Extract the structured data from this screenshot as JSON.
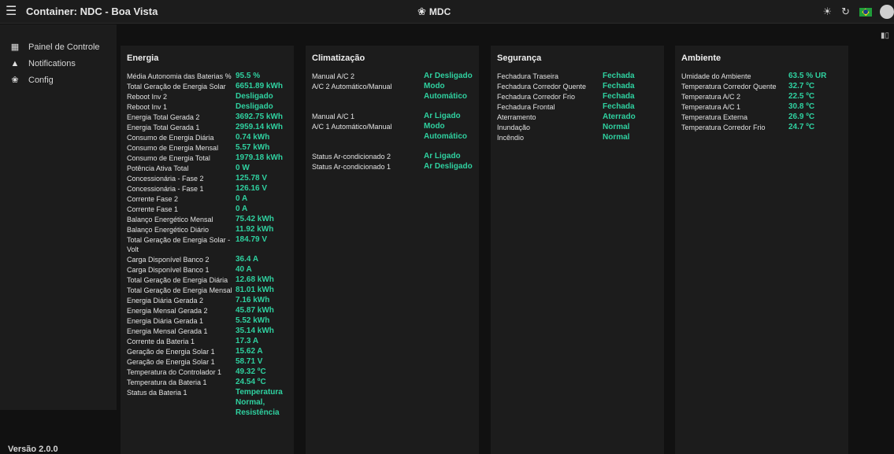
{
  "header": {
    "menu_icon": "menu-icon",
    "title": "Container: NDC - Boa Vista",
    "center_title": "MDC",
    "center_icon": "gear-icon",
    "actions": [
      "brightness-icon",
      "refresh-icon",
      "brazil-flag-icon",
      "user-avatar"
    ]
  },
  "sidebar": {
    "items": [
      {
        "label": "Painel de Controle",
        "icon": "dashboard-icon"
      },
      {
        "label": "Notifications",
        "icon": "bell-icon"
      },
      {
        "label": "Config",
        "icon": "gear-icon"
      }
    ],
    "version": "Versão 2.0.0"
  },
  "colors": {
    "value": "#2fd1a0",
    "card": "#1c1c1c",
    "background": "#111111"
  },
  "cards": {
    "energia": {
      "title": "Energia",
      "rows": [
        {
          "label": "Média Autonomia das Baterias %",
          "value": "95.5 %"
        },
        {
          "label": "Total Geração de Energia Solar",
          "value": "6651.89 kWh"
        },
        {
          "label": "Reboot Inv 2",
          "value": "Desligado"
        },
        {
          "label": "Reboot Inv 1",
          "value": "Desligado"
        },
        {
          "label": "Energia Total Gerada 2",
          "value": "3692.75 kWh"
        },
        {
          "label": "Energia Total Gerada 1",
          "value": "2959.14 kWh"
        },
        {
          "label": "Consumo de Energia Diária",
          "value": "0.74 kWh"
        },
        {
          "label": "Consumo de Energia Mensal",
          "value": "5.57 kWh"
        },
        {
          "label": "Consumo de Energia Total",
          "value": "1979.18 kWh"
        },
        {
          "label": "Potência Ativa Total",
          "value": "0 W"
        },
        {
          "label": "Concessionária - Fase 2",
          "value": "125.78 V"
        },
        {
          "label": "Concessionária - Fase 1",
          "value": "126.16 V"
        },
        {
          "label": "Corrente Fase 2",
          "value": "0 A"
        },
        {
          "label": "Corrente Fase 1",
          "value": "0 A"
        },
        {
          "label": "Balanço Energético Mensal",
          "value": "75.42 kWh"
        },
        {
          "label": "Balanço Energético Diário",
          "value": "11.92 kWh"
        },
        {
          "label": "Total Geração de Energia Solar - Volt",
          "value": "184.79 V"
        },
        {
          "label": "Carga Disponível Banco 2",
          "value": "36.4 A"
        },
        {
          "label": "Carga Disponível Banco 1",
          "value": "40 A"
        },
        {
          "label": "Total Geração de Energia Diária",
          "value": "12.68 kWh"
        },
        {
          "label": "Total Geração de Energia Mensal",
          "value": "81.01 kWh"
        },
        {
          "label": "Energia Diária Gerada 2",
          "value": "7.16 kWh"
        },
        {
          "label": "Energia Mensal Gerada 2",
          "value": "45.87 kWh"
        },
        {
          "label": "Energia Diária Gerada 1",
          "value": "5.52 kWh"
        },
        {
          "label": "Energia Mensal Gerada 1",
          "value": "35.14 kWh"
        },
        {
          "label": "Corrente da Bateria 1",
          "value": "17.3 A"
        },
        {
          "label": "Geração de Energia Solar 1",
          "value": "15.62 A"
        },
        {
          "label": "Geração de Energia Solar 1",
          "value": "58.71 V"
        },
        {
          "label": "Temperatura do Controlador 1",
          "value": "49.32 ºC"
        },
        {
          "label": "Temperatura da Bateria 1",
          "value": "24.54 ºC"
        },
        {
          "label": "Status da Bateria 1",
          "value": "Temperatura Normal, Resistência"
        }
      ]
    },
    "climatizacao": {
      "title": "Climatização",
      "rows": [
        {
          "label": "Manual A/C 2",
          "value": "Ar Desligado"
        },
        {
          "label": "A/C 2 Automático/Manual",
          "value": "Modo Automático"
        },
        {
          "label": "Manual A/C 1",
          "value": "Ar Ligado"
        },
        {
          "label": "A/C 1 Automático/Manual",
          "value": "Modo Automático"
        },
        {
          "label": "Status Ar-condicionado 2",
          "value": "Ar Ligado"
        },
        {
          "label": "Status Ar-condicionado 1",
          "value": "Ar Desligado"
        }
      ]
    },
    "seguranca": {
      "title": "Segurança",
      "rows": [
        {
          "label": "Fechadura Traseira",
          "value": "Fechada"
        },
        {
          "label": "Fechadura Corredor Quente",
          "value": "Fechada"
        },
        {
          "label": "Fechadura Corredor Frio",
          "value": "Fechada"
        },
        {
          "label": "Fechadura Frontal",
          "value": "Fechada"
        },
        {
          "label": "Aterramento",
          "value": "Aterrado"
        },
        {
          "label": "Inundação",
          "value": "Normal"
        },
        {
          "label": "Incêndio",
          "value": "Normal"
        }
      ]
    },
    "ambiente": {
      "title": "Ambiente",
      "rows": [
        {
          "label": "Umidade do Ambiente",
          "value": "63.5 % UR"
        },
        {
          "label": "Temperatura Corredor Quente",
          "value": "32.7 ºC"
        },
        {
          "label": "Temperatura A/C 2",
          "value": "22.5 ºC"
        },
        {
          "label": "Temperatura A/C 1",
          "value": "30.8 ºC"
        },
        {
          "label": "Temperatura Externa",
          "value": "26.9 ºC"
        },
        {
          "label": "Temperatura Corredor Frio",
          "value": "24.7 ºC"
        }
      ]
    }
  },
  "view_toggle_icon": "bar-chart-icon"
}
